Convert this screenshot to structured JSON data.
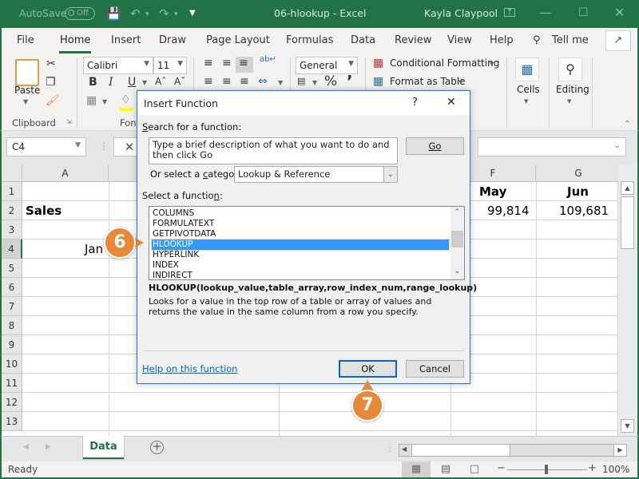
{
  "titlebar": {
    "autosave_label": "AutoSave",
    "autosave_state": "Off",
    "title": "06-hlookup  -  Excel",
    "user": "Kayla Claypool"
  },
  "ribbon_tabs": [
    "File",
    "Home",
    "Insert",
    "Draw",
    "Page Layout",
    "Formulas",
    "Data",
    "Review",
    "View",
    "Help"
  ],
  "active_tab": "Home",
  "tell_me": "Tell me",
  "ribbon": {
    "paste_label": "Paste",
    "clipboard_group": "Clipboard",
    "font_group": "Font",
    "font_name": "Calibri",
    "font_size": "11",
    "bold": "B",
    "italic": "I",
    "underline": "U",
    "number_format": "General",
    "percent": "%",
    "comma": "’",
    "conditional_formatting": "Conditional Formatting",
    "format_as_table": "Format as Table",
    "cells_label": "Cells",
    "editing_label": "Editing"
  },
  "formula_bar": {
    "name_box": "C4",
    "cancel_symbol": "✕"
  },
  "grid": {
    "columns": [
      {
        "label": "A"
      },
      {
        "label": "F"
      },
      {
        "label": "G"
      }
    ],
    "rows": [
      "1",
      "2",
      "3",
      "4",
      "5",
      "6",
      "7",
      "8",
      "9",
      "10",
      "11",
      "12",
      "13"
    ],
    "selected_row": "4",
    "cells": {
      "A2": "Sales",
      "A4": "Jan",
      "F1": "May",
      "G1": "Jun",
      "F2": "99,814",
      "G2": "109,681"
    }
  },
  "sheet_tabs": [
    "Data"
  ],
  "status": {
    "ready": "Ready",
    "zoom": "100%"
  },
  "dialog": {
    "title": "Insert Function",
    "help_symbol": "?",
    "close_symbol": "✕",
    "search_label_u": "S",
    "search_label_rest": "earch for a function:",
    "search_placeholder": "Type a brief description of what you want to do and then click Go",
    "go_label": "Go",
    "category_label_pre": "Or select a ",
    "category_label_u": "c",
    "category_label_post": "ategory:",
    "category_value": "Lookup & Reference",
    "select_label_pre": "Select a functio",
    "select_label_u": "n",
    "select_label_post": ":",
    "functions": [
      "COLUMNS",
      "FORMULATEXT",
      "GETPIVOTDATA",
      "HLOOKUP",
      "HYPERLINK",
      "INDEX",
      "INDIRECT"
    ],
    "selected_function": "HLOOKUP",
    "signature": "HLOOKUP(lookup_value,table_array,row_index_num,range_lookup)",
    "description": "Looks for a value in the top row of a table or array of values and returns the value in the same column from a row you specify.",
    "help_link": "Help on this function",
    "ok_label": "OK",
    "cancel_label": "Cancel"
  },
  "callouts": {
    "step6": "6",
    "step7": "7"
  },
  "colors": {
    "excel_green": "#217346",
    "callout_orange": "#e8893a",
    "selection_blue": "#3399ff",
    "link_blue": "#0563c1"
  }
}
